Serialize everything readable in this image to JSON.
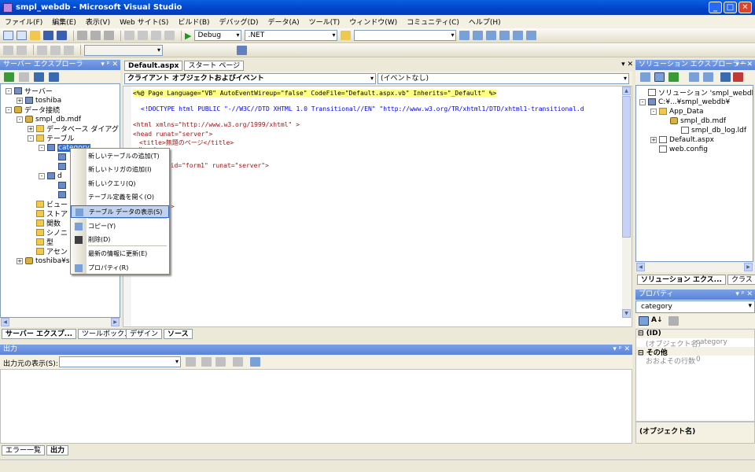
{
  "window": {
    "title": "smpl_webdb - Microsoft Visual Studio",
    "minimize": "_",
    "maximize": "□",
    "close": "✕"
  },
  "menu": [
    "ファイル(F)",
    "編集(E)",
    "表示(V)",
    "Web サイト(S)",
    "ビルド(B)",
    "デバッグ(D)",
    "データ(A)",
    "ツール(T)",
    "ウィンドウ(W)",
    "コミュニティ(C)",
    "ヘルプ(H)"
  ],
  "toolbar": {
    "config": "Debug",
    "platform": ".NET"
  },
  "server_explorer": {
    "title": "サーバー エクスプローラ",
    "tree": [
      {
        "label": "サーバー",
        "level": 0,
        "exp": "-",
        "icon": "srv"
      },
      {
        "label": "toshiba",
        "level": 1,
        "exp": "+",
        "icon": "srv"
      },
      {
        "label": "データ接続",
        "level": 0,
        "exp": "-",
        "icon": "dbi"
      },
      {
        "label": "smpl_db.mdf",
        "level": 1,
        "exp": "-",
        "icon": "dbi"
      },
      {
        "label": "データベース ダイアグラム",
        "level": 2,
        "exp": "+",
        "icon": "folder"
      },
      {
        "label": "テーブル",
        "level": 2,
        "exp": "-",
        "icon": "folder"
      },
      {
        "label": "category",
        "level": 3,
        "exp": "-",
        "icon": "tbl"
      },
      {
        "label": "",
        "level": 4,
        "exp": "",
        "icon": "tbl"
      },
      {
        "label": "",
        "level": 4,
        "exp": "",
        "icon": "tbl"
      },
      {
        "label": "d",
        "level": 3,
        "exp": "-",
        "icon": "tbl"
      },
      {
        "label": "",
        "level": 4,
        "exp": "",
        "icon": "tbl"
      },
      {
        "label": "",
        "level": 4,
        "exp": "",
        "icon": "tbl"
      },
      {
        "label": "ビュー",
        "level": 2,
        "exp": "",
        "icon": "folder"
      },
      {
        "label": "ストア",
        "level": 2,
        "exp": "",
        "icon": "folder"
      },
      {
        "label": "関数",
        "level": 2,
        "exp": "",
        "icon": "folder"
      },
      {
        "label": "シノニ",
        "level": 2,
        "exp": "",
        "icon": "folder"
      },
      {
        "label": "型",
        "level": 2,
        "exp": "",
        "icon": "folder"
      },
      {
        "label": "アセン",
        "level": 2,
        "exp": "",
        "icon": "folder"
      },
      {
        "label": "toshiba¥s",
        "level": 1,
        "exp": "+",
        "icon": "dbi"
      }
    ],
    "bottom_tabs": [
      "サーバー エクスプ...",
      "ツールボックス"
    ]
  },
  "context_menu": [
    {
      "label": "新しいテーブルの追加(T)"
    },
    {
      "label": "新しいトリガの追加(I)"
    },
    {
      "label": "新しいクエリ(Q)"
    },
    {
      "label": "テーブル定義を開く(O)"
    },
    {
      "label": "テーブル データの表示(S)",
      "selected": true
    },
    {
      "label": "コピー(Y)"
    },
    {
      "label": "削除(D)"
    },
    {
      "label": "最新の情報に更新(E)"
    },
    {
      "label": "プロパティ(R)"
    }
  ],
  "editor": {
    "tabs": [
      "Default.aspx",
      "スタート ページ"
    ],
    "close": "▾ ✕",
    "left_combo": "クライアント オブジェクトおよびイベント",
    "right_combo": "(イベントなし)",
    "lines": [
      {
        "text": "<%@ Page Language=\"VB\" AutoEventWireup=\"false\" CodeFile=\"Default.aspx.vb\" Inherits=\"_Default\" %>"
      },
      {
        "text": "<!DOCTYPE html PUBLIC \"-//W3C//DTD XHTML 1.0 Transitional//EN\" \"http://www.w3.org/TR/xhtml1/DTD/xhtml1-transitional.d"
      },
      {
        "text": "<html xmlns=\"http://www.w3.org/1999/xhtml\" >"
      },
      {
        "text": "<head runat=\"server\">"
      },
      {
        "text": "    <title>無題のページ</title>"
      },
      {
        "text": "</head>"
      },
      {
        "text": "m id=\"form1\" runat=\"server\">"
      },
      {
        "text": ">"
      },
      {
        "text": ">"
      },
      {
        "text": "v>"
      },
      {
        "text": "rm>"
      }
    ],
    "bottom_tabs": [
      "デザイン",
      "ソース"
    ]
  },
  "solution_explorer": {
    "title": "ソリューション エクスプローラー - ...",
    "tree": [
      {
        "label": "ソリューション 'smpl_webdb' (1 プロジ",
        "level": 0,
        "exp": "",
        "icon": "file"
      },
      {
        "label": "C:¥...¥smpl_webdb¥",
        "level": 0,
        "exp": "-",
        "icon": "srv"
      },
      {
        "label": "App_Data",
        "level": 1,
        "exp": "-",
        "icon": "folder"
      },
      {
        "label": "smpl_db.mdf",
        "level": 2,
        "exp": "",
        "icon": "dbi"
      },
      {
        "label": "smpl_db_log.ldf",
        "level": 3,
        "exp": "",
        "icon": "file"
      },
      {
        "label": "Default.aspx",
        "level": 1,
        "exp": "+",
        "icon": "file"
      },
      {
        "label": "web.config",
        "level": 1,
        "exp": "",
        "icon": "file"
      }
    ],
    "bottom_tabs": [
      "ソリューション エクス...",
      "クラス ビュー"
    ]
  },
  "properties": {
    "title": "プロパティ",
    "object": "category",
    "sections": [
      {
        "header": "(ID)",
        "name": "(オブジェクト名)",
        "value": "category"
      },
      {
        "header": "その他",
        "name": "おおよその行数",
        "value": "0"
      }
    ],
    "description": "(オブジェクト名)"
  },
  "output": {
    "title": "出力",
    "source_label": "出力元の表示(S):",
    "bottom_tabs": [
      "エラー一覧",
      "出力"
    ]
  }
}
